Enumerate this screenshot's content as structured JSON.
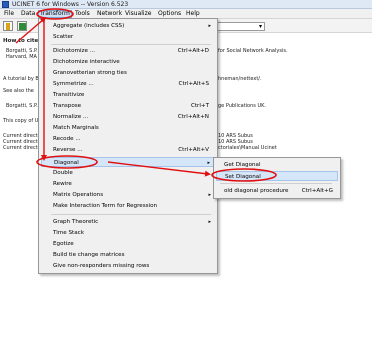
{
  "window": {
    "title": "UCINET 6 for Windows -- Version 6.523"
  },
  "menubar": {
    "items": [
      "File",
      "Data",
      "Transform",
      "Tools",
      "Network",
      "Visualize",
      "Options",
      "Help"
    ],
    "active": "Transform"
  },
  "toolbar": {
    "combo_arrow": "▾"
  },
  "document": {
    "lines": {
      "how_to_cite": "How to cite",
      "cite_1": "Borgatti, S.P.",
      "cite_1_end": "for Social Network Analysis.",
      "cite_2": "Harvard, MA",
      "tutorial": "A tutorial by B",
      "tutorial_end": "hneman/nettext/.",
      "see_also": "See also the",
      "borgatti2": "Borgatti, S.P.",
      "borgatti2_end": "ge Publications UK.",
      "copy": "This copy of U",
      "curdir1": "Current directo",
      "curdir1_end": "10 ARS Subus",
      "curdir2": "Current directo",
      "curdir2_end": "10 ARS Subus",
      "curdir3": "Current directo",
      "curdir3_end": "ctoriales\\Manual Ucinet"
    }
  },
  "transform_menu": {
    "items": [
      {
        "label": "Aggregate (includes CSS)",
        "shortcut": "",
        "submenu": true
      },
      {
        "label": "Scatter",
        "shortcut": "",
        "submenu": false
      },
      {
        "label": "Dichotomize ...",
        "shortcut": "Ctrl+Alt+D",
        "submenu": false
      },
      {
        "label": "Dichotomize interactive",
        "shortcut": "",
        "submenu": false
      },
      {
        "label": "Granovetterian strong ties",
        "shortcut": "",
        "submenu": false
      },
      {
        "label": "Symmetrize ...",
        "shortcut": "Ctrl+Alt+S",
        "submenu": false
      },
      {
        "label": "Transitivize",
        "shortcut": "",
        "submenu": false
      },
      {
        "label": "Transpose",
        "shortcut": "Ctrl+T",
        "submenu": false
      },
      {
        "label": "Normalize ...",
        "shortcut": "Ctrl+Alt+N",
        "submenu": false
      },
      {
        "label": "Match Marginals",
        "shortcut": "",
        "submenu": false
      },
      {
        "label": "Recode ...",
        "shortcut": "",
        "submenu": false
      },
      {
        "label": "Reverse ...",
        "shortcut": "Ctrl+Alt+V",
        "submenu": false
      },
      {
        "label": "Diagonal",
        "shortcut": "",
        "submenu": true
      },
      {
        "label": "Double",
        "shortcut": "",
        "submenu": false
      },
      {
        "label": "Rewire",
        "shortcut": "",
        "submenu": false
      },
      {
        "label": "Matrix Operations",
        "shortcut": "",
        "submenu": true
      },
      {
        "label": "Make Interaction Term for Regression",
        "shortcut": "",
        "submenu": false
      },
      {
        "label": "Graph Theoretic",
        "shortcut": "",
        "submenu": true
      },
      {
        "label": "Time Stack",
        "shortcut": "",
        "submenu": false
      },
      {
        "label": "Egotize",
        "shortcut": "",
        "submenu": false
      },
      {
        "label": "Build tie change matrices",
        "shortcut": "",
        "submenu": false
      },
      {
        "label": "Give non-responders missing rows",
        "shortcut": "",
        "submenu": false
      }
    ],
    "highlighted": "Diagonal"
  },
  "diagonal_menu": {
    "items": [
      {
        "label": "Get Diagonal",
        "shortcut": ""
      },
      {
        "label": "Set Diagonal",
        "shortcut": ""
      },
      {
        "label": "old diagonal procedure",
        "shortcut": "Ctrl+Alt+G"
      }
    ],
    "highlighted": "Set Diagonal"
  },
  "icons": {
    "submenu_arrow": "▸",
    "app_icon": "ucinet-app-icon",
    "open_icon": "open-file-icon",
    "excel_icon": "spreadsheet-icon"
  },
  "colors": {
    "annotation": "#e01010",
    "highlight": "#d6e6f9"
  }
}
